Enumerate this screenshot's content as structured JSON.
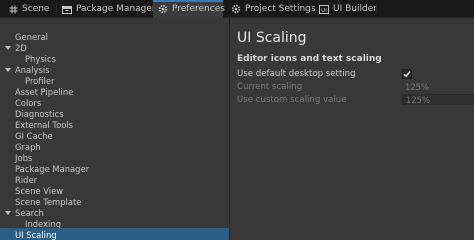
{
  "tabs": [
    {
      "label": "Scene",
      "icon": "hashtag-grid-icon",
      "active": false
    },
    {
      "label": "Package Manager",
      "icon": "package-box-icon",
      "active": false
    },
    {
      "label": "Preferences",
      "icon": "gear-icon",
      "active": true
    },
    {
      "label": "Project Settings",
      "icon": "gear-icon",
      "active": false
    },
    {
      "label": "UI Builder",
      "icon": "ui-builder-icon",
      "active": false
    }
  ],
  "sidebar": {
    "items": [
      {
        "label": "General",
        "indent": 0,
        "expandable": false
      },
      {
        "label": "2D",
        "indent": 0,
        "expandable": true
      },
      {
        "label": "Physics",
        "indent": 1,
        "expandable": false
      },
      {
        "label": "Analysis",
        "indent": 0,
        "expandable": true
      },
      {
        "label": "Profiler",
        "indent": 1,
        "expandable": false
      },
      {
        "label": "Asset Pipeline",
        "indent": 0,
        "expandable": false
      },
      {
        "label": "Colors",
        "indent": 0,
        "expandable": false
      },
      {
        "label": "Diagnostics",
        "indent": 0,
        "expandable": false
      },
      {
        "label": "External Tools",
        "indent": 0,
        "expandable": false
      },
      {
        "label": "GI Cache",
        "indent": 0,
        "expandable": false
      },
      {
        "label": "Graph",
        "indent": 0,
        "expandable": false
      },
      {
        "label": "Jobs",
        "indent": 0,
        "expandable": false
      },
      {
        "label": "Package Manager",
        "indent": 0,
        "expandable": false
      },
      {
        "label": "Rider",
        "indent": 0,
        "expandable": false
      },
      {
        "label": "Scene View",
        "indent": 0,
        "expandable": false
      },
      {
        "label": "Scene Template",
        "indent": 0,
        "expandable": false
      },
      {
        "label": "Search",
        "indent": 0,
        "expandable": true
      },
      {
        "label": "Indexing",
        "indent": 1,
        "expandable": false
      },
      {
        "label": "UI Scaling",
        "indent": 0,
        "expandable": false,
        "selected": true
      }
    ]
  },
  "main": {
    "title": "UI Scaling",
    "section": "Editor icons and text scaling",
    "fields": {
      "use_default": {
        "label": "Use default desktop setting",
        "checked": true
      },
      "current_scaling": {
        "label": "Current scaling",
        "value": "125%"
      },
      "custom_scaling": {
        "label": "Use custom scaling value",
        "value": "125%"
      }
    }
  },
  "colors": {
    "accent": "#3a79bb",
    "selection": "#2c5d87",
    "background": "#383838",
    "tabbar": "#191919"
  }
}
